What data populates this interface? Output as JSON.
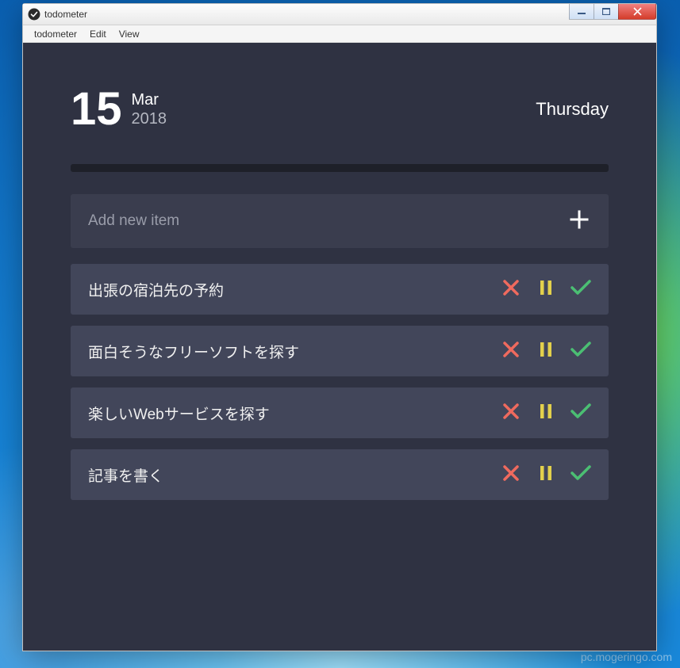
{
  "window": {
    "title": "todometer"
  },
  "menubar": {
    "items": [
      "todometer",
      "Edit",
      "View"
    ]
  },
  "date": {
    "day": "15",
    "month": "Mar",
    "year": "2018",
    "weekday": "Thursday"
  },
  "add": {
    "placeholder": "Add new item"
  },
  "todos": [
    {
      "text": "出張の宿泊先の予約"
    },
    {
      "text": "面白そうなフリーソフトを探す"
    },
    {
      "text": "楽しいWebサービスを探す"
    },
    {
      "text": "記事を書く"
    }
  ],
  "colors": {
    "delete": "#ef6a5e",
    "pause": "#e2d04c",
    "done": "#4bbf73"
  },
  "watermark": "pc.mogeringo.com"
}
